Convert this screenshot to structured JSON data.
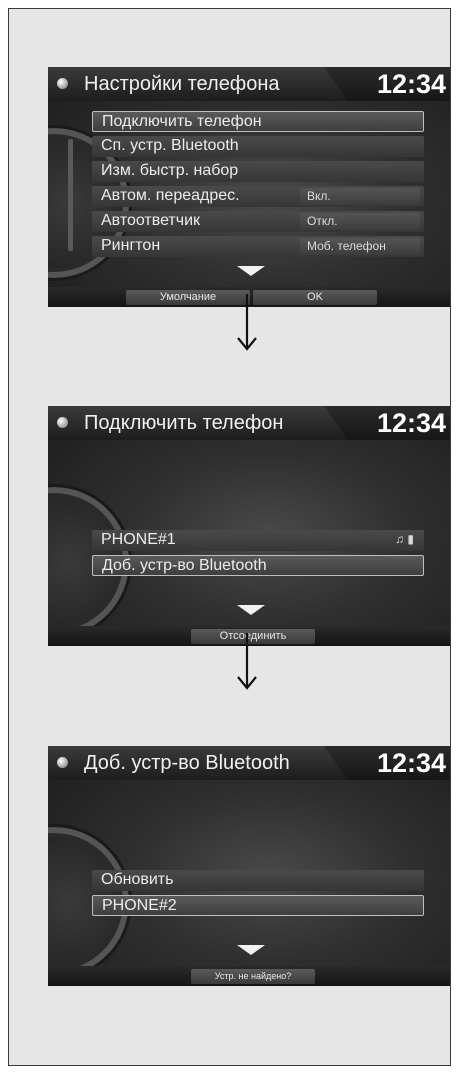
{
  "screens": [
    {
      "title": "Настройки телефона",
      "clock": "12:34",
      "items": [
        {
          "label": "Подключить телефон",
          "value": ""
        },
        {
          "label": "Сп. устр. Bluetooth",
          "value": ""
        },
        {
          "label": "Изм. быстр. набор",
          "value": ""
        },
        {
          "label": "Автом. переадрес.",
          "value": "Вкл."
        },
        {
          "label": "Автоответчик",
          "value": "Откл."
        },
        {
          "label": "Рингтон",
          "value": "Моб. телефон"
        }
      ],
      "softkeys": [
        "Умолчание",
        "OK"
      ]
    },
    {
      "title": "Подключить телефон",
      "clock": "12:34",
      "items": [
        {
          "label": "PHONE#1",
          "value": "",
          "icons": "♫ ▮"
        },
        {
          "label": "Доб. устр-во Bluetooth",
          "value": ""
        }
      ],
      "softkeys": [
        "Отсоединить"
      ]
    },
    {
      "title": "Доб. устр-во Bluetooth",
      "clock": "12:34",
      "items": [
        {
          "label": "Обновить",
          "value": ""
        },
        {
          "label": "PHONE#2",
          "value": ""
        }
      ],
      "softkeys": [
        "Устр. не найдено?"
      ]
    }
  ],
  "icons": {
    "title_dot": "status-dot-icon",
    "scroll_down": "chevron-down-icon",
    "flow_arrow": "arrow-down-icon",
    "phone_status": "music-and-battery-icon"
  }
}
